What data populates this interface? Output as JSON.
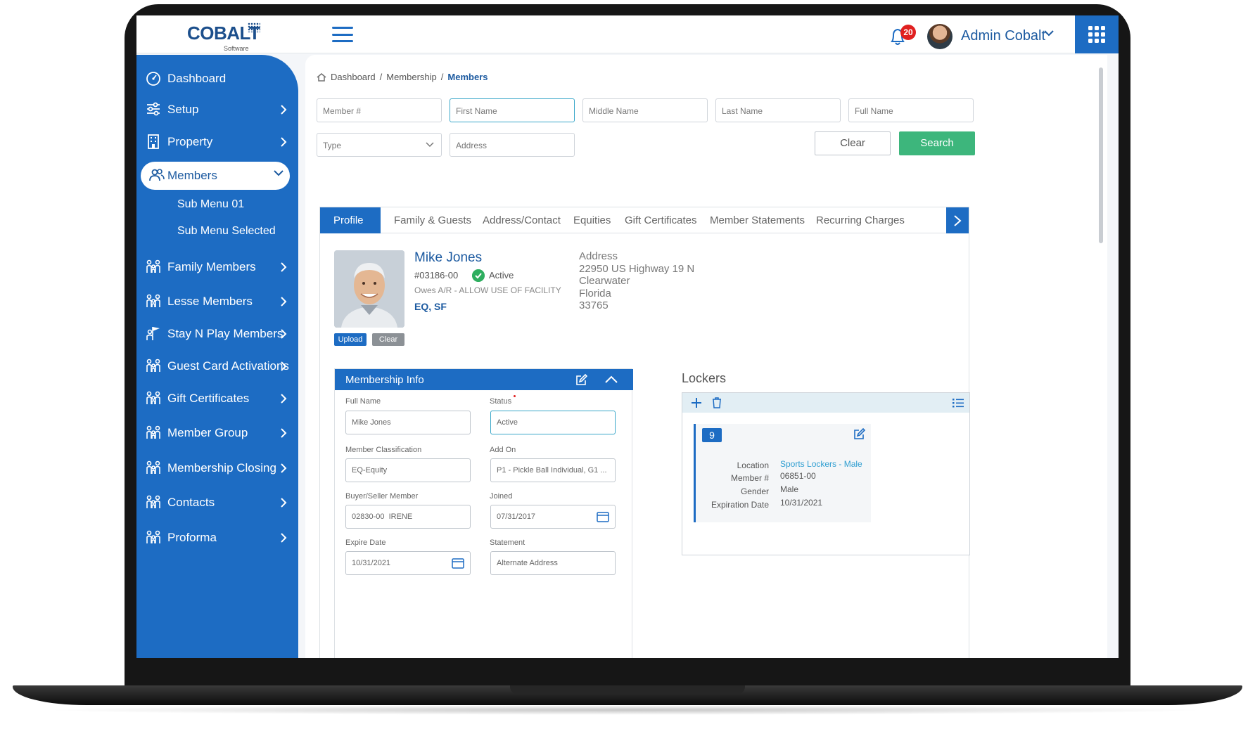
{
  "colors": {
    "primary": "#1d6cc3",
    "success": "#3db67c",
    "badge": "#e02020",
    "status_active": "#2eae5f"
  },
  "header": {
    "logo_text": "COBALT",
    "logo_sub": "Software",
    "notification_count": "20",
    "user_name": "Admin Cobalt"
  },
  "sidebar": {
    "items": [
      {
        "label": "Dashboard",
        "icon": "dashboard-icon"
      },
      {
        "label": "Setup",
        "icon": "sliders-icon"
      },
      {
        "label": "Property",
        "icon": "building-icon"
      },
      {
        "label": "Members",
        "icon": "users-icon"
      },
      {
        "label": "Family Members",
        "icon": "family-icon"
      },
      {
        "label": "Lesse Members",
        "icon": "family-icon"
      },
      {
        "label": "Stay N Play Members",
        "icon": "flag-person-icon"
      },
      {
        "label": "Guest Card Activations",
        "icon": "family-icon"
      },
      {
        "label": "Gift Certificates",
        "icon": "family-icon"
      },
      {
        "label": "Member Group",
        "icon": "family-icon"
      },
      {
        "label": "Membership Closing",
        "icon": "family-icon"
      },
      {
        "label": "Contacts",
        "icon": "family-icon"
      },
      {
        "label": "Proforma",
        "icon": "family-icon"
      }
    ],
    "submenu": [
      "Sub Menu 01",
      "Sub Menu Selected"
    ]
  },
  "breadcrumb": {
    "part1": "Dashboard",
    "sep": "/",
    "part2": "Membership",
    "current": "Members"
  },
  "search": {
    "member_no": "Member #",
    "first_name": "First Name",
    "middle_name": "Middle Name",
    "last_name": "Last Name",
    "full_name": "Full Name",
    "type": "Type",
    "address": "Address",
    "clear_label": "Clear",
    "search_label": "Search"
  },
  "tabs": [
    "Profile",
    "Family & Guests",
    "Address/Contact",
    "Equities",
    "Gift Certificates",
    "Member Statements",
    "Recurring Charges"
  ],
  "profile": {
    "name": "Mike Jones",
    "member_id": "#03186-00",
    "status": "Active",
    "owes": "Owes A/R - ALLOW USE OF FACILITY",
    "codes": "EQ, SF",
    "upload_label": "Upload",
    "clear_label": "Clear",
    "address_label": "Address",
    "address_lines": [
      "22950 US Highway 19 N",
      "Clearwater",
      "Florida",
      "33765"
    ]
  },
  "membership_info": {
    "title": "Membership Info",
    "full_name_label": "Full Name",
    "full_name": "Mike Jones",
    "status_label": "Status",
    "status": "Active",
    "classification_label": "Member Classification",
    "classification": "EQ-Equity",
    "add_on_label": "Add On",
    "add_on": "P1 - Pickle Ball Individual, G1 ...",
    "buyer_label": "Buyer/Seller Member",
    "buyer": "02830-00  IRENE",
    "joined_label": "Joined",
    "joined": "07/31/2017",
    "expire_label": "Expire Date",
    "expire": "10/31/2021",
    "statement_label": "Statement",
    "statement": "Alternate Address"
  },
  "lockers": {
    "title": "Lockers",
    "number": "9",
    "location_label": "Location",
    "location": "Sports Lockers - Male",
    "member_label": "Member #",
    "member": "06851-00",
    "gender_label": "Gender",
    "gender": "Male",
    "expiration_label": "Expiration Date",
    "expiration": "10/31/2021"
  }
}
